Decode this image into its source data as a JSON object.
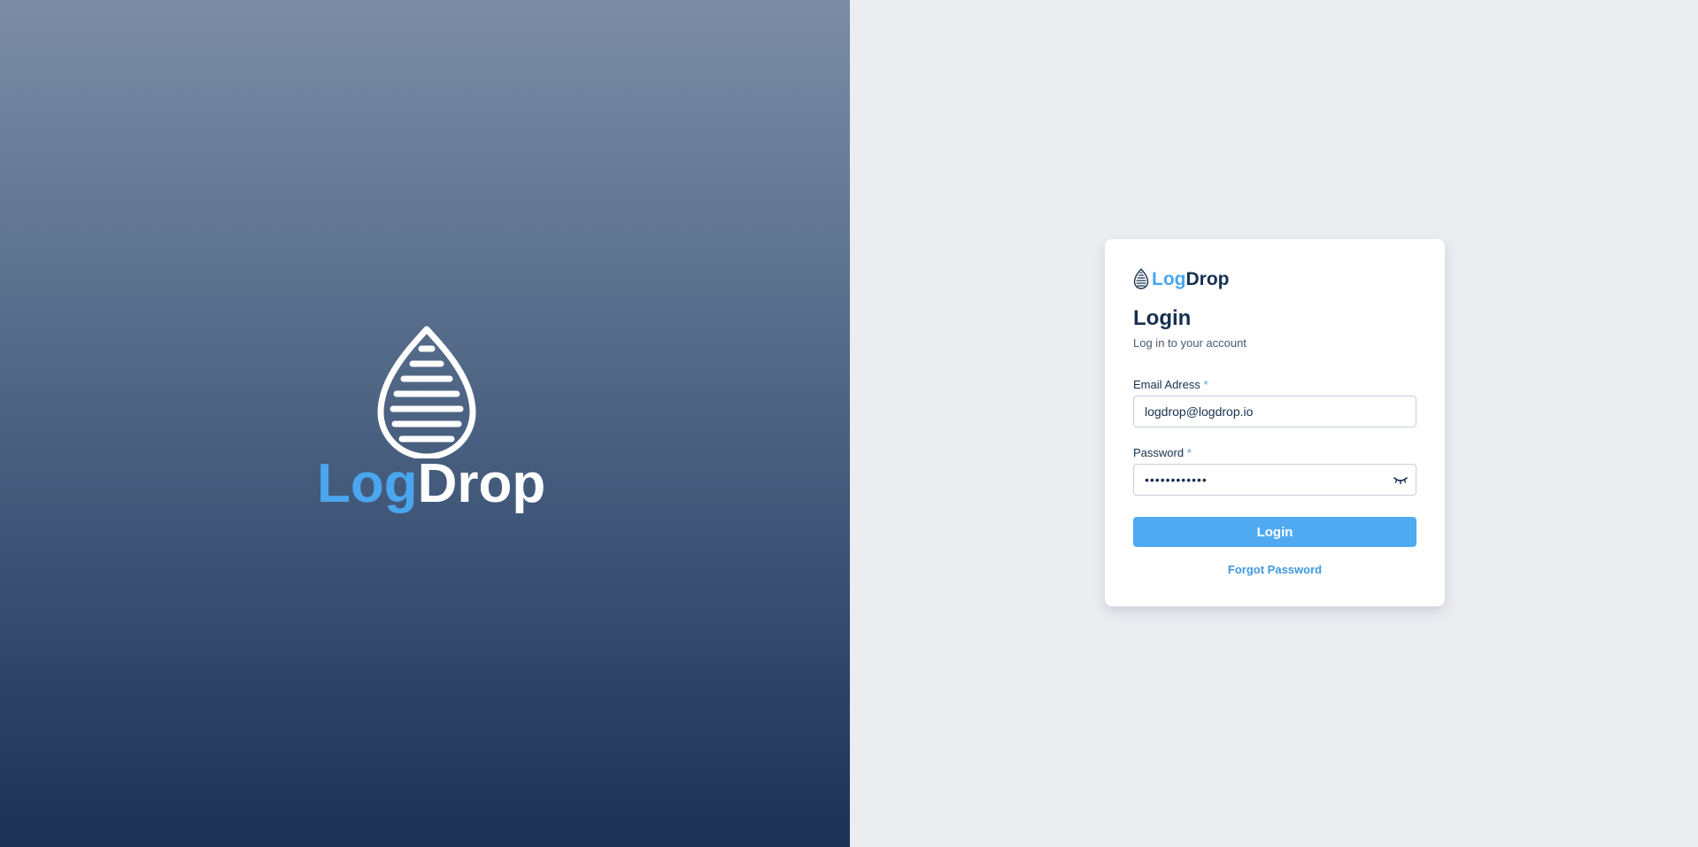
{
  "hero": {
    "logo_word_part1": "Log",
    "logo_word_part2": "Drop"
  },
  "card": {
    "brand_part1": "Log",
    "brand_part2": "Drop",
    "title": "Login",
    "subtitle": "Log in to your account",
    "email": {
      "label": "Email Adress",
      "required_mark": "*",
      "value": "logdrop@logdrop.io"
    },
    "password": {
      "label": "Password",
      "required_mark": "*",
      "value": "••••••••••••",
      "toggle_icon": "eye-closed-icon"
    },
    "login_button": "Login",
    "forgot_link": "Forgot Password"
  },
  "colors": {
    "accent": "#4faaf2",
    "brand_light": "#4aa6ee",
    "brand_dark": "#16304f",
    "hero_top": "#7c8ca5",
    "hero_bottom": "#1b3256",
    "panel_bg": "#ebedf1"
  }
}
